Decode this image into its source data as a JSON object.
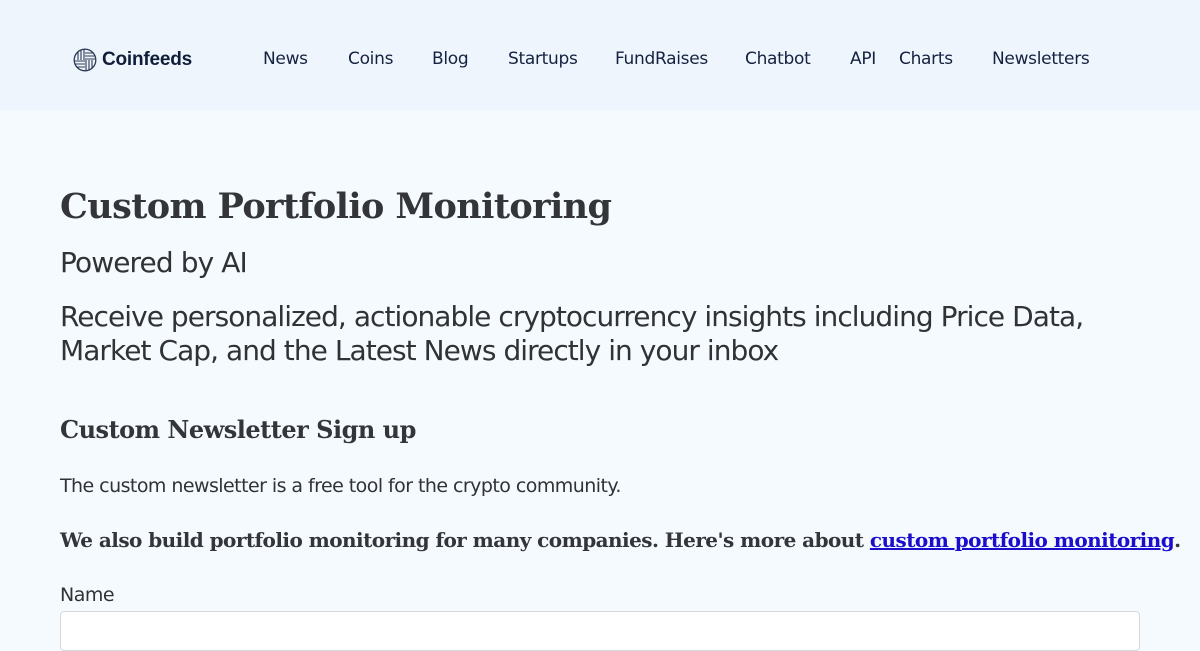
{
  "header": {
    "logo": {
      "icon": "coin-weave-icon",
      "text": "Coinfeeds"
    },
    "nav": [
      {
        "label": "News"
      },
      {
        "label": "Coins"
      },
      {
        "label": "Blog"
      },
      {
        "label": "Startups"
      },
      {
        "label": "FundRaises"
      },
      {
        "label": "Chatbot"
      },
      {
        "label": "API"
      },
      {
        "label": "Charts"
      },
      {
        "label": "Newsletters"
      }
    ]
  },
  "main": {
    "title": "Custom Portfolio Monitoring",
    "subtitle": "Powered by AI",
    "lede": "Receive personalized, actionable cryptocurrency insights including Price Data, Market Cap, and the Latest News directly in your inbox",
    "signup_heading": "Custom Newsletter Sign up",
    "note": "The custom newsletter is a free tool for the crypto community.",
    "promo": {
      "text": "We also build portfolio monitoring for many companies. Here's more about ",
      "link_text": "custom portfolio monitoring",
      "suffix": "."
    },
    "form": {
      "name_label": "Name",
      "name_value": "",
      "name_placeholder": ""
    }
  },
  "colors": {
    "header_bg": "#eff5fd",
    "page_bg": "#f5faff",
    "nav_text": "#13223f",
    "link": "#1a0dcc",
    "body_text": "#303234"
  }
}
